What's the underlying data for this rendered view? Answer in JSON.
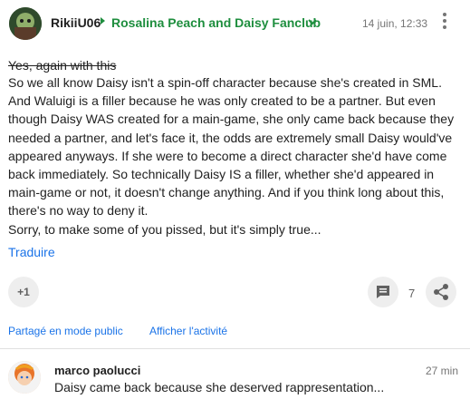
{
  "post": {
    "author": "RikiiU06",
    "community": "Rosalina Peach and Daisy Fanclub",
    "timestamp": "14 juin, 12:33",
    "strikethrough_line": "Yes, again with this",
    "paragraphs": [
      "So we all know Daisy isn't a spin-off character because she's created in SML. And Waluigi is a filler because he was only created to be a partner. But even though Daisy WAS created for a main-game, she only came back because they needed a partner, and let's face it, the odds are extremely small Daisy would've appeared anyways. If she were to become a direct character she'd have come back immediately. So technically Daisy IS a filler, whether she'd appeared in main-game or not, it doesn't change anything. And if you think long about this, there's no way to deny it.",
      "Sorry, to make some of you pissed, but it's simply true..."
    ],
    "translate_label": "Traduire",
    "plus_one_label": "+1",
    "comment_count": "7",
    "shared_label": "Partagé en mode public",
    "activity_label": "Afficher l'activité"
  },
  "comment": {
    "author": "marco paolucci",
    "time": "27 min",
    "text": "Daisy came back because she deserved rappresentation..."
  },
  "icons": {
    "community_chevron": "chevron-down-icon",
    "more": "more-vert-icon",
    "comment": "comment-icon",
    "share": "share-icon"
  },
  "colors": {
    "community": "#1e8e3e",
    "link": "#1a73e8",
    "button_bg": "#eeeeee"
  }
}
